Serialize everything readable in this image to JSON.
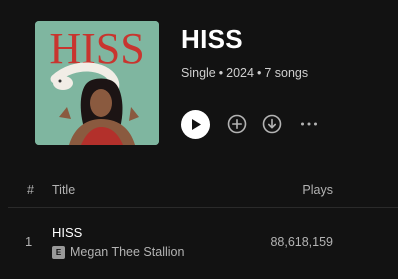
{
  "album": {
    "title": "HISS",
    "type": "Single",
    "year": "2024",
    "song_count": "7 songs",
    "cover_text": "HISS"
  },
  "actions": {
    "play_icon": "play-icon",
    "add_icon": "plus-circle-icon",
    "download_icon": "download-icon",
    "more_icon": "more-icon"
  },
  "table": {
    "headers": {
      "number": "#",
      "title": "Title",
      "plays": "Plays"
    },
    "tracks": [
      {
        "number": "1",
        "title": "HISS",
        "explicit_label": "E",
        "artist": "Megan Thee Stallion",
        "plays": "88,618,159"
      }
    ]
  },
  "colors": {
    "background": "#121212",
    "text_primary": "#ffffff",
    "text_secondary": "#b3b3b3",
    "cover_bg": "#7fb6a0",
    "cover_title": "#c8352f"
  }
}
